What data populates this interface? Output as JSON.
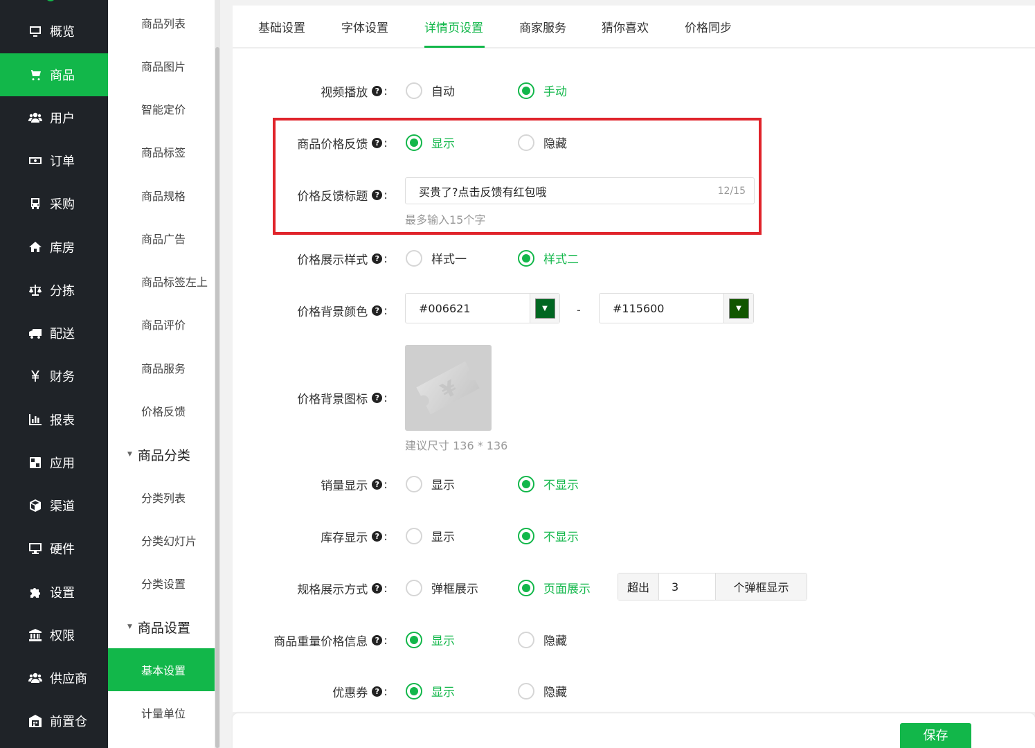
{
  "sidebar": {
    "items": [
      {
        "label": "概览",
        "icon": "monitor-icon"
      },
      {
        "label": "商品",
        "icon": "cart-icon",
        "active": true
      },
      {
        "label": "用户",
        "icon": "users-icon"
      },
      {
        "label": "订单",
        "icon": "money-icon"
      },
      {
        "label": "采购",
        "icon": "truck-front-icon"
      },
      {
        "label": "库房",
        "icon": "home-icon"
      },
      {
        "label": "分拣",
        "icon": "scale-icon"
      },
      {
        "label": "配送",
        "icon": "delivery-truck-icon"
      },
      {
        "label": "财务",
        "icon": "yen-icon"
      },
      {
        "label": "报表",
        "icon": "bar-chart-icon"
      },
      {
        "label": "应用",
        "icon": "apps-icon"
      },
      {
        "label": "渠道",
        "icon": "cube-icon"
      },
      {
        "label": "硬件",
        "icon": "desktop-icon"
      },
      {
        "label": "设置",
        "icon": "puzzle-icon"
      },
      {
        "label": "权限",
        "icon": "bank-icon"
      },
      {
        "label": "供应商",
        "icon": "users-icon"
      },
      {
        "label": "前置仓",
        "icon": "warehouse-icon"
      }
    ]
  },
  "submenu": {
    "items": [
      "商品列表",
      "商品图片",
      "智能定价",
      "商品标签",
      "商品规格",
      "商品广告",
      "商品标签左上",
      "商品评价",
      "商品服务",
      "价格反馈"
    ],
    "group1": {
      "label": "商品分类",
      "items": [
        "分类列表",
        "分类幻灯片",
        "分类设置"
      ]
    },
    "group2": {
      "label": "商品设置",
      "items": [
        "基本设置",
        "计量单位"
      ],
      "active": "基本设置"
    }
  },
  "tabs": [
    "基础设置",
    "字体设置",
    "详情页设置",
    "商家服务",
    "猜你喜欢",
    "价格同步"
  ],
  "active_tab": "详情页设置",
  "form": {
    "video": {
      "label": "视频播放",
      "options": [
        "自动",
        "手动"
      ],
      "selected": "手动"
    },
    "price_feedback": {
      "label": "商品价格反馈",
      "options": [
        "显示",
        "隐藏"
      ],
      "selected": "显示"
    },
    "feedback_title": {
      "label": "价格反馈标题",
      "value": "买贵了?点击反馈有红包哦",
      "counter": "12/15",
      "hint": "最多输入15个字"
    },
    "price_style": {
      "label": "价格展示样式",
      "options": [
        "样式一",
        "样式二"
      ],
      "selected": "样式二"
    },
    "bg_color": {
      "label": "价格背景颜色",
      "from": "#006621",
      "to": "#115600",
      "dash": "-",
      "swatch_from": "#006621",
      "swatch_to": "#115600"
    },
    "bg_icon": {
      "label": "价格背景图标",
      "hint": "建议尺寸 136 * 136"
    },
    "sales": {
      "label": "销量显示",
      "options": [
        "显示",
        "不显示"
      ],
      "selected": "不显示"
    },
    "stock": {
      "label": "库存显示",
      "options": [
        "显示",
        "不显示"
      ],
      "selected": "不显示"
    },
    "spec": {
      "label": "规格展示方式",
      "options": [
        "弹框展示",
        "页面展示"
      ],
      "selected": "页面展示",
      "prefix": "超出",
      "value": "3",
      "suffix": "个弹框显示"
    },
    "weight_price": {
      "label": "商品重量价格信息",
      "options": [
        "显示",
        "隐藏"
      ],
      "selected": "显示"
    },
    "coupon": {
      "label": "优惠券",
      "options": [
        "显示",
        "隐藏"
      ],
      "selected": "显示"
    }
  },
  "help_glyph": "?",
  "colon": ":",
  "save_label": "保存",
  "colors": {
    "accent": "#12b74a",
    "sidebar_bg": "#1f2328",
    "highlight": "#e0242b"
  }
}
